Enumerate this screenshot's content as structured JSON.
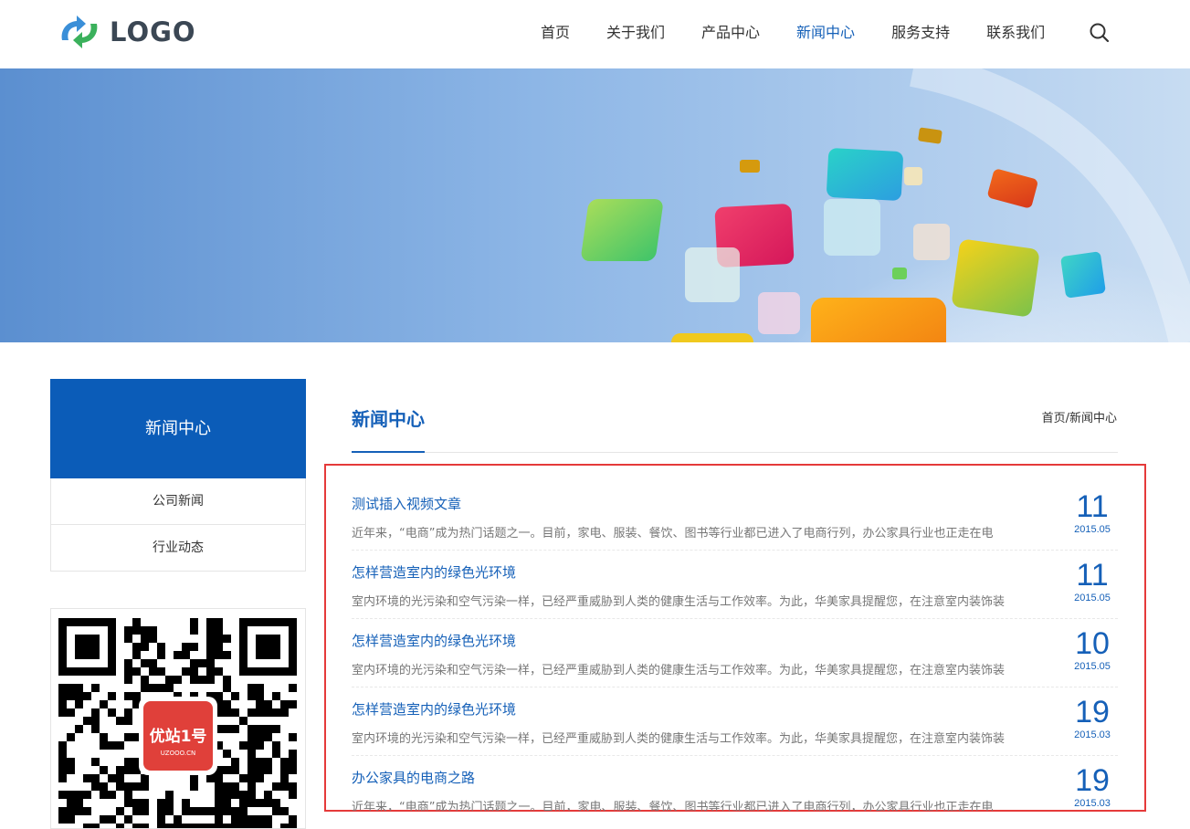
{
  "header": {
    "logo_text": "LOGO",
    "nav": [
      {
        "label": "首页",
        "active": false
      },
      {
        "label": "关于我们",
        "active": false
      },
      {
        "label": "产品中心",
        "active": false
      },
      {
        "label": "新闻中心",
        "active": true
      },
      {
        "label": "服务支持",
        "active": false
      },
      {
        "label": "联系我们",
        "active": false
      }
    ],
    "search_icon": "search-icon"
  },
  "sidebar": {
    "title": "新闻中心",
    "items": [
      {
        "label": "公司新闻"
      },
      {
        "label": "行业动态"
      }
    ],
    "qr_badge_text": "优站1号",
    "qr_badge_sub": "UZOOO.CN"
  },
  "main": {
    "title": "新闻中心",
    "breadcrumb": {
      "home": "首页",
      "separator": "/",
      "current": "新闻中心"
    },
    "news": [
      {
        "title": "测试插入视频文章",
        "desc": "近年来，“电商”成为热门话题之一。目前，家电、服装、餐饮、图书等行业都已进入了电商行列，办公家具行业也正走在电",
        "day": "11",
        "month": "2015.05"
      },
      {
        "title": "怎样营造室内的绿色光环境",
        "desc": "室内环境的光污染和空气污染一样，已经严重威胁到人类的健康生活与工作效率。为此，华美家具提醒您，在注意室内装饰装",
        "day": "11",
        "month": "2015.05"
      },
      {
        "title": "怎样营造室内的绿色光环境",
        "desc": "室内环境的光污染和空气污染一样，已经严重威胁到人类的健康生活与工作效率。为此，华美家具提醒您，在注意室内装饰装",
        "day": "10",
        "month": "2015.05"
      },
      {
        "title": "怎样营造室内的绿色光环境",
        "desc": "室内环境的光污染和空气污染一样，已经严重威胁到人类的健康生活与工作效率。为此，华美家具提醒您，在注意室内装饰装",
        "day": "19",
        "month": "2015.03"
      },
      {
        "title": "办公家具的电商之路",
        "desc": "近年来，“电商”成为热门话题之一。目前，家电、服装、餐饮、图书等行业都已进入了电商行列，办公家具行业也正走在电",
        "day": "19",
        "month": "2015.03"
      }
    ]
  },
  "colors": {
    "accent": "#1560b8",
    "sidebar_header": "#0b5cb8",
    "highlight_border": "#e53a3a"
  }
}
